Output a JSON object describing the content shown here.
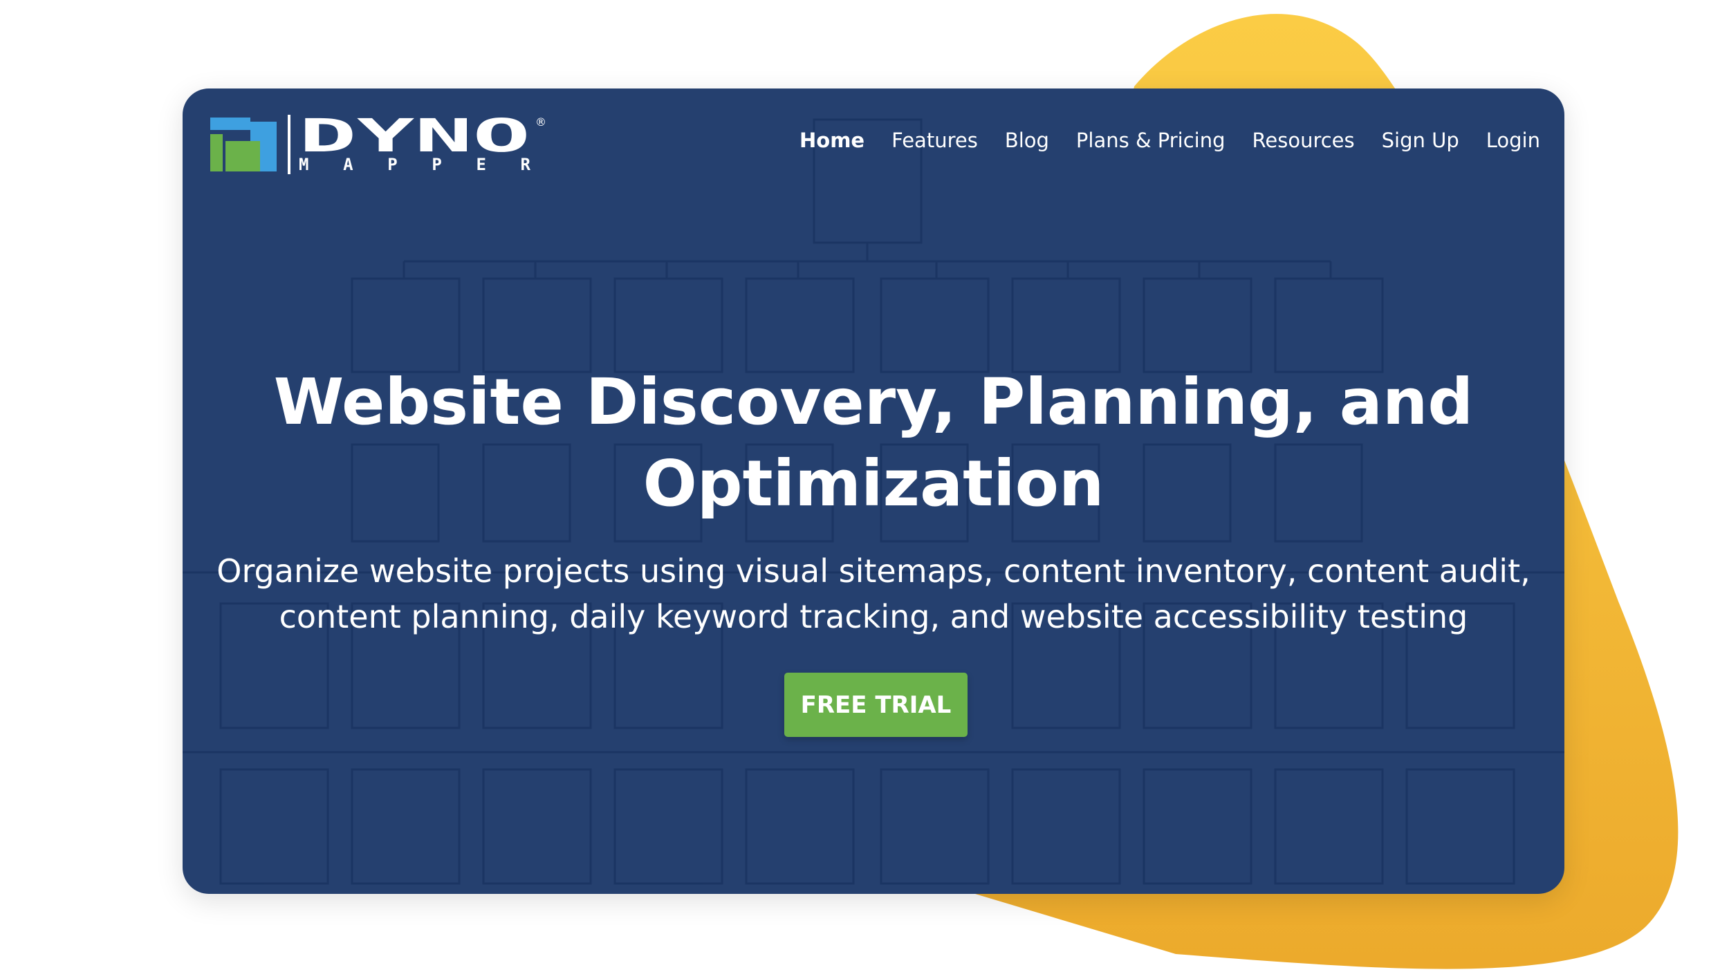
{
  "colors": {
    "card_background": "#25406f",
    "accent_yellow": "#f5bb36",
    "cta_green": "#6bb24a",
    "logo_green": "#6bb24a",
    "logo_blue": "#3ea0e0",
    "text": "#ffffff"
  },
  "logo": {
    "wordmark": "DYNO",
    "sub": "MAPPER",
    "mark": "®",
    "icon": "dyno-mapper-logo-icon"
  },
  "nav": {
    "items": [
      {
        "label": "Home",
        "active": true
      },
      {
        "label": "Features",
        "active": false
      },
      {
        "label": "Blog",
        "active": false
      },
      {
        "label": "Plans & Pricing",
        "active": false
      },
      {
        "label": "Resources",
        "active": false
      },
      {
        "label": "Sign Up",
        "active": false
      },
      {
        "label": "Login",
        "active": false
      }
    ]
  },
  "hero": {
    "title_line1": "Website Discovery, Planning, and",
    "title_line2": "Optimization",
    "subtitle_line1": "Organize website projects using visual sitemaps, content inventory, content audit,",
    "subtitle_line2": "content planning, daily keyword tracking, and website accessibility testing",
    "cta_label": "FREE TRIAL"
  }
}
